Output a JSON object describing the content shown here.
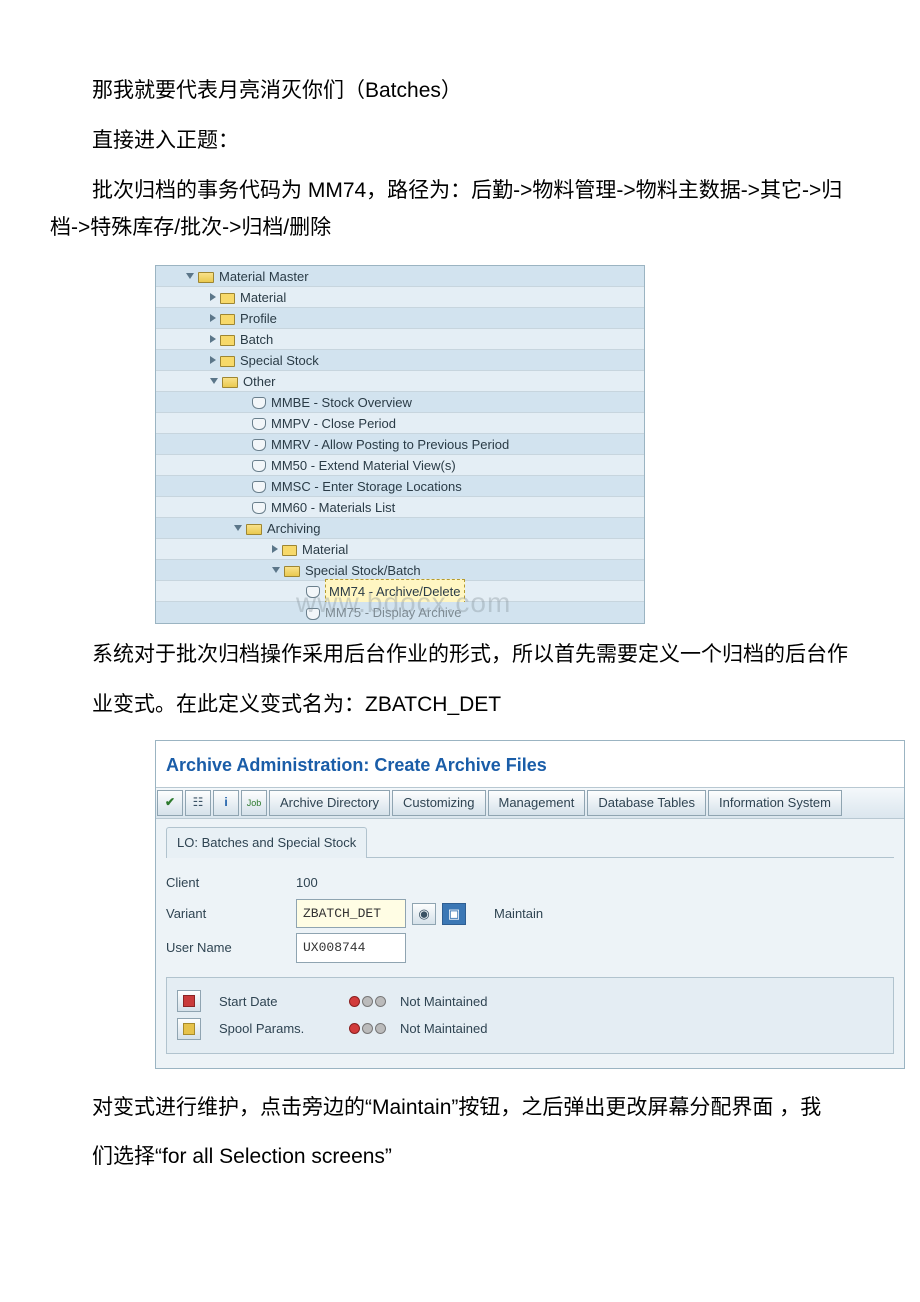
{
  "paragraphs": {
    "p1": "那我就要代表月亮消灭你们（Batches）",
    "p2": "直接进入正题：",
    "p3": "批次归档的事务代码为 MM74，路径为：后勤->物料管理->物料主数据->其它->归档->特殊库存/批次->归档/删除",
    "p4": "系统对于批次归档操作采用后台作业的形式，所以首先需要定义一个归档的后台作",
    "p5": "业变式。在此定义变式名为：ZBATCH_DET",
    "p6": "对变式进行维护，点击旁边的“Maintain”按钮，之后弹出更改屏幕分配界面 ，我",
    "p7": "们选择“for all Selection screens”"
  },
  "tree": {
    "material_master": "Material Master",
    "material": "Material",
    "profile": "Profile",
    "batch": "Batch",
    "special_stock": "Special Stock",
    "other": "Other",
    "mmbe": "MMBE - Stock Overview",
    "mmpv": "MMPV - Close Period",
    "mmrv": "MMRV - Allow Posting to Previous Period",
    "mm50": "MM50 - Extend Material View(s)",
    "mmsc": "MMSC - Enter Storage Locations",
    "mm60": "MM60 - Materials List",
    "archiving": "Archiving",
    "material2": "Material",
    "spec_batch": "Special Stock/Batch",
    "mm74": "MM74 - Archive/Delete",
    "mm75": "MM75 - Display Archive",
    "watermark": "www.bdocx.com"
  },
  "sap": {
    "title": "Archive Administration: Create Archive Files",
    "toolbar": {
      "archive_dir": "Archive Directory",
      "customizing": "Customizing",
      "management": "Management",
      "db_tables": "Database Tables",
      "info_sys": "Information System"
    },
    "section": "LO: Batches and Special Stock",
    "client_label": "Client",
    "client_value": "100",
    "variant_label": "Variant",
    "variant_value": "ZBATCH_DET",
    "maintain": "Maintain",
    "user_label": "User Name",
    "user_value": "UX008744",
    "start_date": "Start Date",
    "spool": "Spool Params.",
    "not_maintained": "Not Maintained"
  }
}
